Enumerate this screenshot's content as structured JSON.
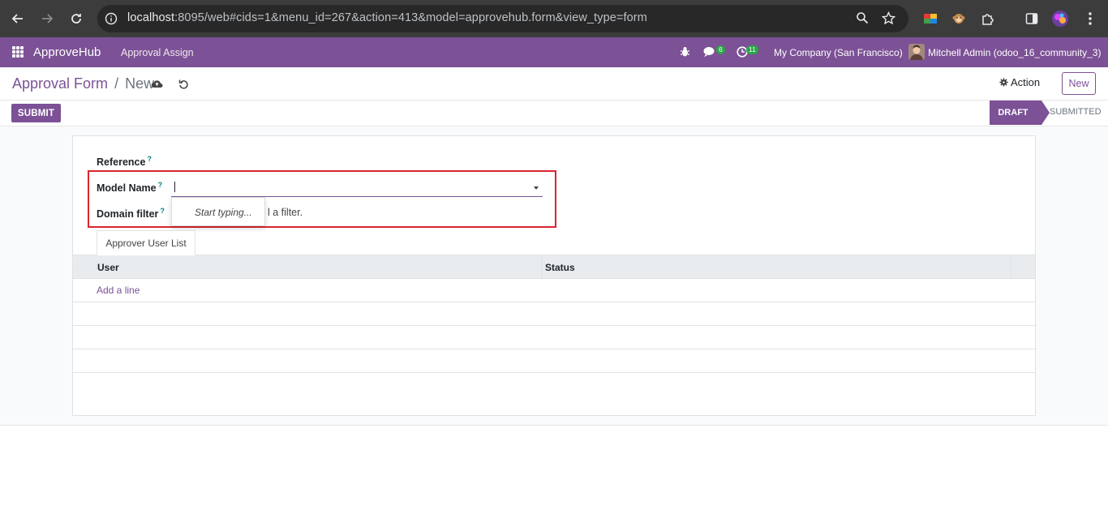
{
  "browser": {
    "url_host": "localhost",
    "url_rest": ":8095/web#cids=1&menu_id=267&action=413&model=approvehub.form&view_type=form"
  },
  "navbar": {
    "app_name": "ApproveHub",
    "menu_item": "Approval Assign",
    "messages_count": "6",
    "activities_count": "11",
    "company": "My Company (San Francisco)",
    "user": "Mitchell Admin (odoo_16_community_3)"
  },
  "control_panel": {
    "breadcrumb_parent": "Approval Form",
    "breadcrumb_separator": "/",
    "breadcrumb_current": "New",
    "action_label": "Action",
    "new_label": "New"
  },
  "statusbar": {
    "submit_label": "SUBMIT",
    "stages": [
      "DRAFT",
      "SUBMITTED"
    ],
    "active_stage": "DRAFT"
  },
  "form": {
    "reference_label": "Reference",
    "model_name_label": "Model Name",
    "model_name_value": "",
    "domain_filter_label": "Domain filter",
    "domain_filter_text": "l a filter.",
    "help_mark": "?",
    "autocomplete_hint": "Start typing...",
    "tab_label": "Approver User List",
    "columns": [
      "User",
      "Status"
    ],
    "add_line_label": "Add a line"
  },
  "colors": {
    "brand": "#7c5196",
    "highlight": "#d9262e",
    "badge": "#28a745"
  }
}
